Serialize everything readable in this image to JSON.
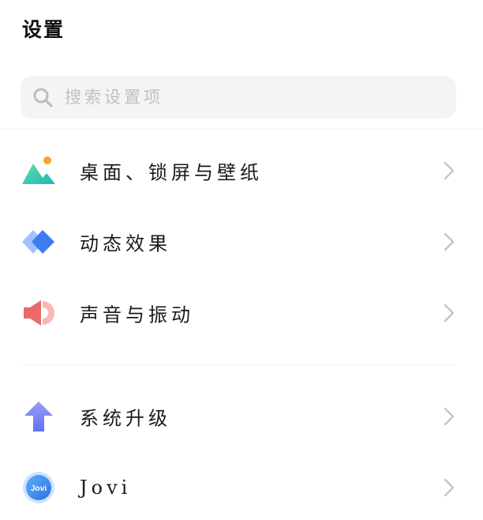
{
  "header": {
    "title": "设置"
  },
  "search": {
    "placeholder": "搜索设置项",
    "icon": "search-icon"
  },
  "settings": {
    "items": [
      {
        "label": "桌面、锁屏与壁纸",
        "icon": "wallpaper-icon"
      },
      {
        "label": "动态效果",
        "icon": "animation-effects-icon"
      },
      {
        "label": "声音与振动",
        "icon": "speaker-icon"
      },
      {
        "label": "系统升级",
        "icon": "upgrade-arrow-icon"
      },
      {
        "label": "Jovi",
        "icon": "jovi-icon",
        "icon_text": "Jovi"
      }
    ]
  },
  "colors": {
    "wallpaper_green": "#3ecf8e",
    "wallpaper_orange": "#f5a623",
    "animation_blue": "#3b82f6",
    "speaker_red": "#e86a6a",
    "upgrade_purple": "#6a7cf0",
    "jovi_blue": "#3d8bf2",
    "chevron_gray": "#c4c4c4"
  }
}
